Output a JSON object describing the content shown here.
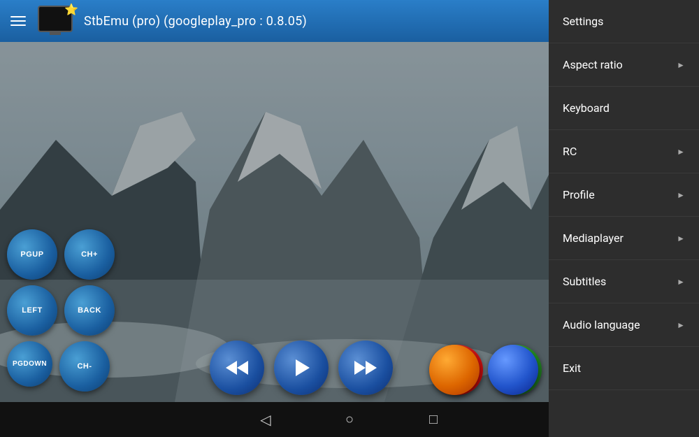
{
  "header": {
    "menu_icon": "menu-icon",
    "tv_icon": "tv-icon",
    "star": "⭐",
    "title": "StbEmu (pro) (googleplay_pro : 0.8.05)"
  },
  "context_menu": {
    "items": [
      {
        "label": "Settings",
        "has_arrow": false
      },
      {
        "label": "Aspect ratio",
        "has_arrow": true
      },
      {
        "label": "Keyboard",
        "has_arrow": false
      },
      {
        "label": "RC",
        "has_arrow": true
      },
      {
        "label": "Profile",
        "has_arrow": true
      },
      {
        "label": "Mediaplayer",
        "has_arrow": true
      },
      {
        "label": "Subtitles",
        "has_arrow": true
      },
      {
        "label": "Audio language",
        "has_arrow": true
      },
      {
        "label": "Exit",
        "has_arrow": false
      }
    ]
  },
  "controls": {
    "buttons": [
      {
        "id": "pgup",
        "label": "PGUP"
      },
      {
        "id": "chplus",
        "label": "CH+"
      },
      {
        "id": "left",
        "label": "LEFT"
      },
      {
        "id": "back",
        "label": "BACK"
      },
      {
        "id": "pgdown",
        "label": "PGDOWN"
      },
      {
        "id": "chminus",
        "label": "CH-"
      }
    ]
  },
  "playback": {
    "rewind": "⏪",
    "play": "▶",
    "forward": "⏩"
  },
  "nav": {
    "back": "◁",
    "home": "○",
    "recents": "□"
  },
  "colors": {
    "header_bg": "#1a6ab5",
    "menu_bg": "#2d2d2d",
    "menu_border": "#3a3a3a",
    "btn_blue": "#1a5fa0",
    "red": "#cc1111",
    "green": "#228822",
    "orange": "#dd6600",
    "blue2": "#2255cc"
  }
}
